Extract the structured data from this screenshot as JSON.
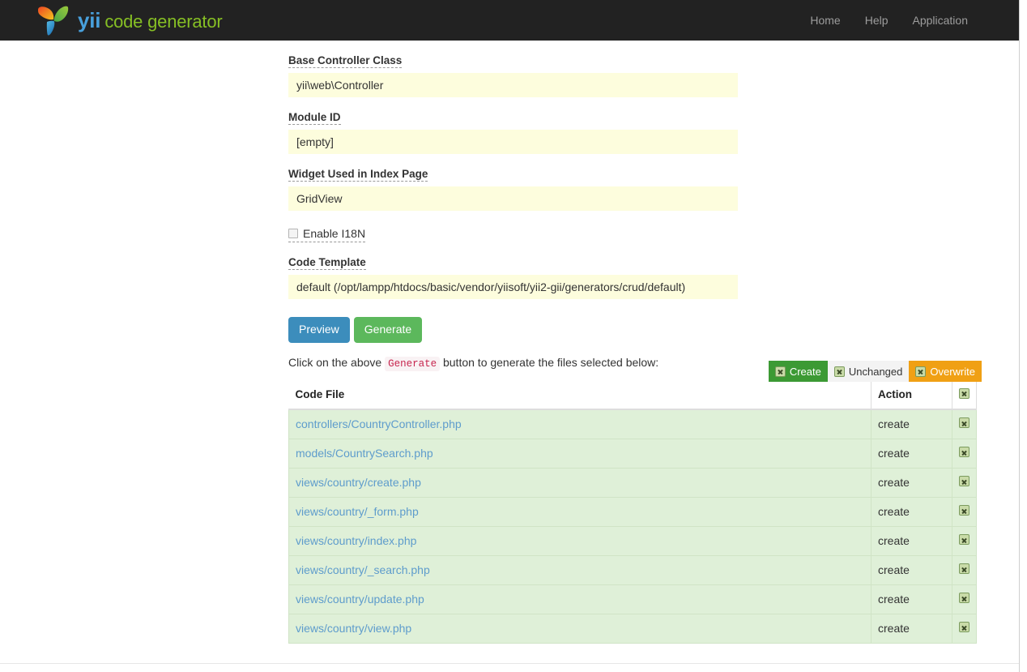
{
  "navbar": {
    "brand": {
      "logo_icon": "yii-butterfly-logo",
      "name": "yii",
      "tagline": "code generator",
      "colors": {
        "yii": "#48a0dc",
        "tagline": "#86bf24",
        "bar": "#222222"
      }
    },
    "links": [
      {
        "label": "Home"
      },
      {
        "label": "Help"
      },
      {
        "label": "Application"
      }
    ]
  },
  "form": {
    "fields": [
      {
        "label": "Base Controller Class",
        "value": "yii\\web\\Controller"
      },
      {
        "label": "Module ID",
        "value": "[empty]"
      },
      {
        "label": "Widget Used in Index Page",
        "value": "GridView"
      }
    ],
    "checkbox": {
      "label": "Enable I18N",
      "checked": false
    },
    "code_template": {
      "label": "Code Template",
      "value": "default (/opt/lampp/htdocs/basic/vendor/yiisoft/yii2-gii/generators/crud/default)"
    },
    "buttons": {
      "preview": "Preview",
      "generate": "Generate",
      "preview_color": "#3c8dbc",
      "generate_color": "#5cb85c"
    }
  },
  "hint": {
    "before": "Click on the above",
    "code": "Generate",
    "after": "button to generate the files selected below:"
  },
  "legend": [
    {
      "label": "Create",
      "color": "#3c9a34",
      "icon": "checkbox-placeholder-icon"
    },
    {
      "label": "Unchanged",
      "color": "#f3f3f3",
      "icon": "checkbox-placeholder-icon"
    },
    {
      "label": "Overwrite",
      "color": "#f0a014",
      "icon": "checkbox-placeholder-icon"
    }
  ],
  "table": {
    "headers": {
      "file": "Code File",
      "action": "Action",
      "check_icon": "checkbox-placeholder-icon"
    },
    "rows": [
      {
        "file": "controllers/CountryController.php",
        "action": "create",
        "checked": true
      },
      {
        "file": "models/CountrySearch.php",
        "action": "create",
        "checked": true
      },
      {
        "file": "views/country/create.php",
        "action": "create",
        "checked": true
      },
      {
        "file": "views/country/_form.php",
        "action": "create",
        "checked": true
      },
      {
        "file": "views/country/index.php",
        "action": "create",
        "checked": true
      },
      {
        "file": "views/country/_search.php",
        "action": "create",
        "checked": true
      },
      {
        "file": "views/country/update.php",
        "action": "create",
        "checked": true
      },
      {
        "file": "views/country/view.php",
        "action": "create",
        "checked": true
      }
    ],
    "row_color": "#dff0d8",
    "link_color": "#5e9ccc"
  }
}
